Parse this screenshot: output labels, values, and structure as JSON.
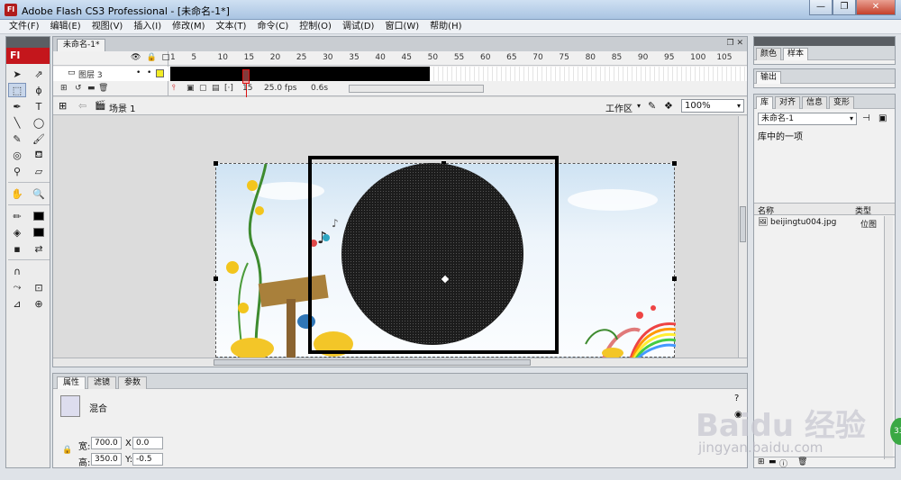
{
  "window": {
    "title": "Adobe Flash CS3 Professional - [未命名-1*]",
    "app_icon": "Fl"
  },
  "menu": [
    "文件(F)",
    "编辑(E)",
    "视图(V)",
    "插入(I)",
    "修改(M)",
    "文本(T)",
    "命令(C)",
    "控制(O)",
    "调试(D)",
    "窗口(W)",
    "帮助(H)"
  ],
  "tools": {
    "logo": "Fl"
  },
  "document": {
    "tab_label": "未命名-1*",
    "timeline": {
      "ruler": [
        "1",
        "5",
        "10",
        "15",
        "20",
        "25",
        "30",
        "35",
        "40",
        "45",
        "50",
        "55",
        "60",
        "65",
        "70",
        "75",
        "80",
        "85",
        "90",
        "95",
        "100",
        "105"
      ],
      "layer_name": "图层 3",
      "current_frame": "15",
      "fps": "25.0 fps",
      "time": "0.6s"
    },
    "scene_label": "场景 1",
    "workspace_label": "工作区",
    "zoom": "100%"
  },
  "properties": {
    "tabs": [
      "属性",
      "滤镜",
      "参数"
    ],
    "blend_label": "混合",
    "width_label": "宽:",
    "width_value": "700.0",
    "height_label": "高:",
    "height_value": "350.0",
    "x_label": "X:",
    "x_value": "0.0",
    "y_label": "Y:",
    "y_value": "-0.5"
  },
  "right_panels": {
    "panel1_tabs": [
      "颜色",
      "样本"
    ],
    "panel2_tabs": [
      "输出"
    ],
    "library_tabs": [
      "库",
      "对齐",
      "信息",
      "变形"
    ],
    "library_select": "未命名-1",
    "library_title": "库中的一项",
    "col_name": "名称",
    "col_type": "类型",
    "item_name": "beijingtu004.jpg",
    "item_type": "位图"
  },
  "watermark": {
    "text": "Baidu 经验",
    "sub": "jingyan.baidu.com",
    "badge": "33"
  }
}
